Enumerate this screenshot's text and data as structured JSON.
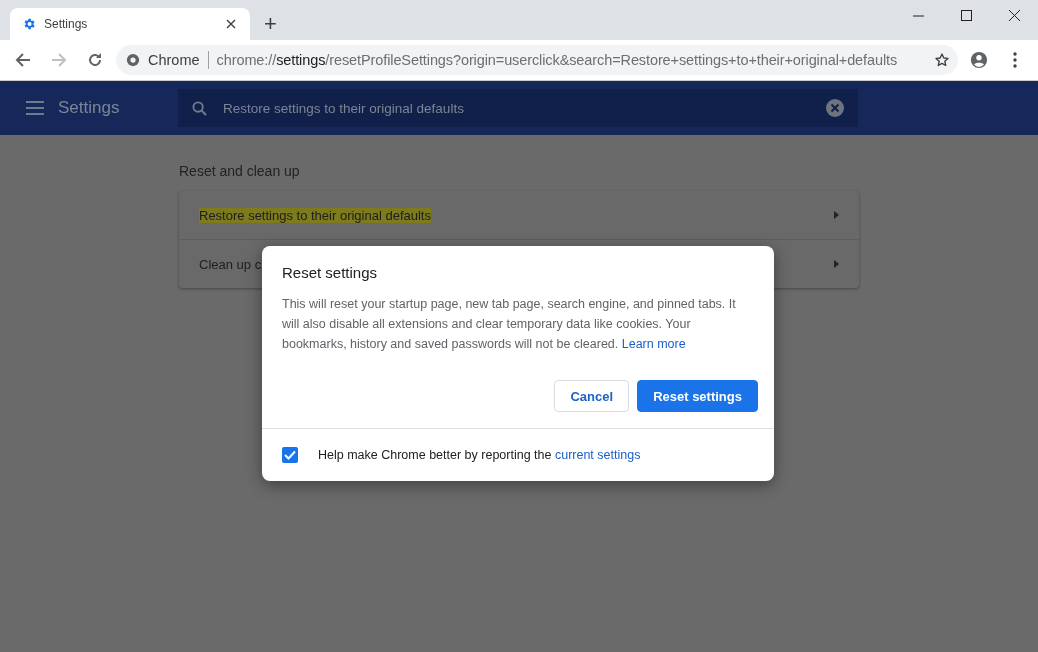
{
  "tab": {
    "title": "Settings",
    "new_tab": "+"
  },
  "toolbar": {
    "forward_disabled": true,
    "site_label": "Chrome",
    "url": "chrome://**settings**/resetProfileSettings?origin=userclick&search=Restore+settings+to+their+original+defaults"
  },
  "header": {
    "title": "Settings",
    "search": {
      "value": "Restore settings to their original defaults"
    }
  },
  "section": {
    "title": "Reset and clean up",
    "items": [
      {
        "label": "Restore settings to their original defaults",
        "highlighted": true
      },
      {
        "label": "Clean up c",
        "highlighted": false
      }
    ]
  },
  "dialog": {
    "title": "Reset settings",
    "body": "This will reset your startup page, new tab page, search engine, and pinned tabs. It will also disable all extensions and clear temporary data like cookies. Your bookmarks, history and saved passwords will not be cleared.",
    "link": "Learn more",
    "buttons": [
      {
        "label": "Cancel",
        "kind": "secondary"
      },
      {
        "label": "Reset settings",
        "kind": "primary"
      }
    ],
    "footer": {
      "checked": true,
      "text": "Help make Chrome better by reporting the",
      "link": "current settings"
    }
  }
}
